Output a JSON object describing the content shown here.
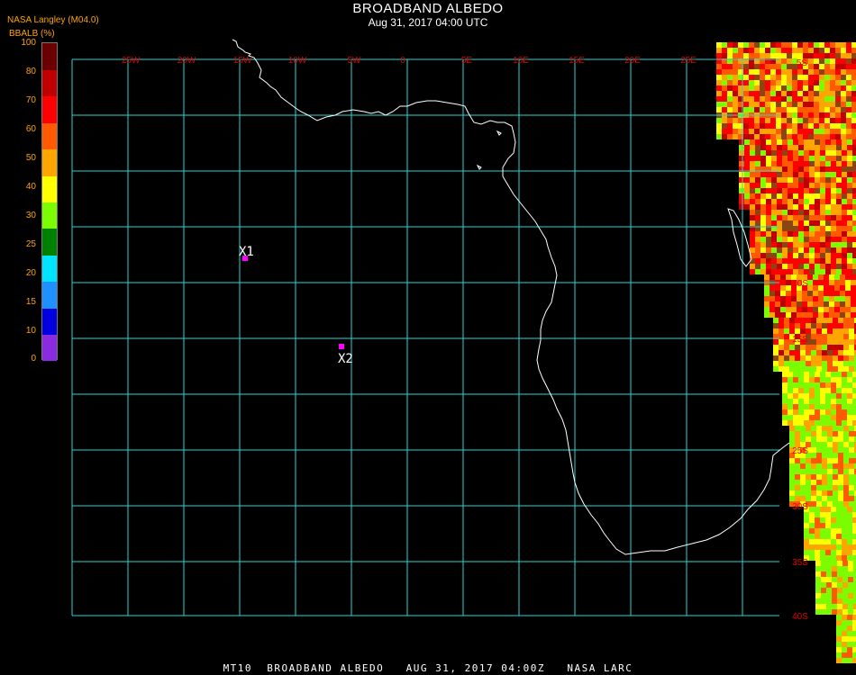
{
  "header": {
    "title": "BROADBAND ALBEDO",
    "subtitle": "Aug 31, 2017 04:00 UTC",
    "provider": "NASA Langley (M04.0)"
  },
  "colorbar": {
    "label": "BBALB (%)",
    "segments": [
      {
        "from": 0,
        "to": 10,
        "color": "#8a2be2"
      },
      {
        "from": 10,
        "to": 15,
        "color": "#0000e0"
      },
      {
        "from": 15,
        "to": 20,
        "color": "#1e90ff"
      },
      {
        "from": 20,
        "to": 25,
        "color": "#00e5ff"
      },
      {
        "from": 25,
        "to": 30,
        "color": "#008000"
      },
      {
        "from": 30,
        "to": 40,
        "color": "#7cfc00"
      },
      {
        "from": 40,
        "to": 50,
        "color": "#ffff00"
      },
      {
        "from": 50,
        "to": 60,
        "color": "#ffa500"
      },
      {
        "from": 60,
        "to": 70,
        "color": "#ff5a00"
      },
      {
        "from": 70,
        "to": 80,
        "color": "#ff0000"
      },
      {
        "from": 80,
        "to": 90,
        "color": "#c00000"
      },
      {
        "from": 90,
        "to": 100,
        "color": "#6b0000"
      }
    ],
    "ticks": [
      "100",
      "80",
      "70",
      "60",
      "50",
      "40",
      "30",
      "25",
      "20",
      "15",
      "10",
      "0"
    ]
  },
  "map": {
    "grid_color": "#2ad4d4",
    "coast_color": "#ffffff",
    "label_color": "#e00000",
    "lon_labels": [
      "25W",
      "20W",
      "15W",
      "10W",
      "5W",
      "0",
      "5E",
      "10E",
      "15E",
      "20E",
      "25E"
    ],
    "lat_labels": [
      "5S",
      "10S",
      "15S",
      "25S",
      "30S",
      "35S",
      "40S"
    ],
    "markers": [
      {
        "label": "X1",
        "color": "#ff00ff"
      },
      {
        "label": "X2",
        "color": "#ff00ff"
      }
    ]
  },
  "footer": {
    "text": "MT10  BROADBAND ALBEDO   AUG 31, 2017 04:00Z   NASA LARC"
  }
}
